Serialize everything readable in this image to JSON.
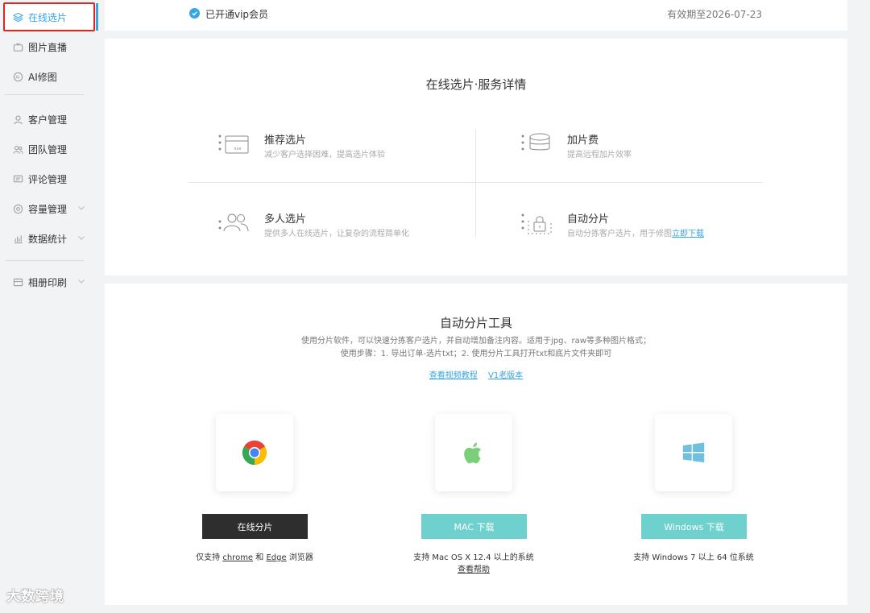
{
  "sidebar": {
    "items": [
      {
        "label": "在线选片",
        "icon": "layers-icon"
      },
      {
        "label": "图片直播",
        "icon": "tv-icon"
      },
      {
        "label": "AI修图",
        "icon": "ai-icon"
      },
      {
        "label": "客户管理",
        "icon": "user-icon"
      },
      {
        "label": "团队管理",
        "icon": "team-icon"
      },
      {
        "label": "评论管理",
        "icon": "comment-icon"
      },
      {
        "label": "容量管理",
        "icon": "storage-icon"
      },
      {
        "label": "数据统计",
        "icon": "chart-icon"
      },
      {
        "label": "相册印刷",
        "icon": "album-icon"
      }
    ],
    "active": "在线选片"
  },
  "vip": {
    "status": "已开通vip会员",
    "expire": "有效期至2026-07-23"
  },
  "service": {
    "title": "在线选片·服务详情",
    "features": [
      {
        "name": "推荐选片",
        "desc": "减少客户选择困难，提高选片体验",
        "icon": "recommend-icon"
      },
      {
        "name": "加片费",
        "desc": "提高远程加片效率",
        "icon": "coins-icon"
      },
      {
        "name": "多人选片",
        "desc": "提供多人在线选片，让复杂的流程简单化",
        "icon": "multi-user-icon"
      },
      {
        "name": "自动分片",
        "desc": "自动分拣客户选片，用于修图",
        "link": "立即下载",
        "icon": "lock-icon"
      }
    ]
  },
  "tool": {
    "title": "自动分片工具",
    "desc_line1": "使用分片软件，可以快速分拣客户选片，并自动增加备注内容。适用于jpg、raw等多种图片格式；",
    "desc_line2": "使用步骤：1. 导出订单-选片txt；2. 使用分片工具打开txt和底片文件夹即可",
    "link_video": "查看视频教程",
    "link_old": "V1老版本",
    "downloads": [
      {
        "button": "在线分片",
        "note_pre": "仅支持",
        "note_chrome": "chrome",
        "note_and": "和",
        "note_edge": "Edge",
        "note_post": "浏览器",
        "icon": "chrome-icon"
      },
      {
        "button": "MAC 下载",
        "note": "支持 Mac OS X 12.4 以上的系统",
        "help": "查看帮助",
        "icon": "apple-icon"
      },
      {
        "button": "Windows 下载",
        "note": "支持 Windows 7 以上 64 位系统",
        "icon": "windows-icon"
      }
    ]
  },
  "watermark": "大数跨境",
  "colors": {
    "accent": "#35a6e5",
    "teal": "#6fd1cd",
    "dark": "#2e2e2e",
    "highlight": "#e1251b"
  }
}
